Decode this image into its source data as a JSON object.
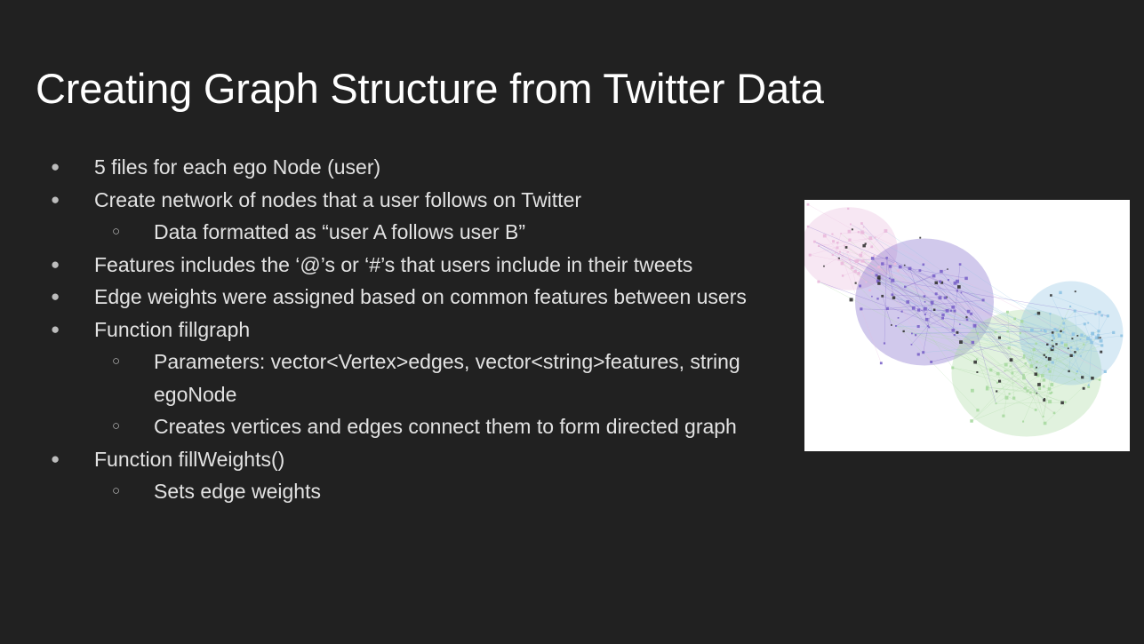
{
  "slide": {
    "title": "Creating Graph Structure from Twitter Data",
    "bullets": [
      {
        "level": 1,
        "text": "5 files for each ego Node (user)"
      },
      {
        "level": 1,
        "text": "Create network of nodes that a user follows on Twitter"
      },
      {
        "level": 2,
        "text": "Data formatted as “user A follows user B”"
      },
      {
        "level": 1,
        "text": "Features includes the ‘@’s or ‘#’s that users include in their tweets"
      },
      {
        "level": 1,
        "text": "Edge weights were assigned based on common features between users"
      },
      {
        "level": 1,
        "text": "Function fillgraph"
      },
      {
        "level": 2,
        "text": "Parameters: vector<Vertex>edges, vector<string>features, string egoNode"
      },
      {
        "level": 2,
        "text": "Creates vertices and edges connect them to form directed graph"
      },
      {
        "level": 1,
        "text": "Function fillWeights()"
      },
      {
        "level": 2,
        "text": "Sets edge weights"
      }
    ],
    "bullet_markers": {
      "level1": "●",
      "level2": "○"
    }
  },
  "graph_image": {
    "icon": "network-graph-visualization",
    "cluster_colors": [
      "#e9b9dc",
      "#7a63c9",
      "#a9d9a1",
      "#8fc3e3"
    ]
  },
  "colors": {
    "background": "#212121",
    "title": "#ffffff",
    "body_text": "#e2e2e2"
  }
}
